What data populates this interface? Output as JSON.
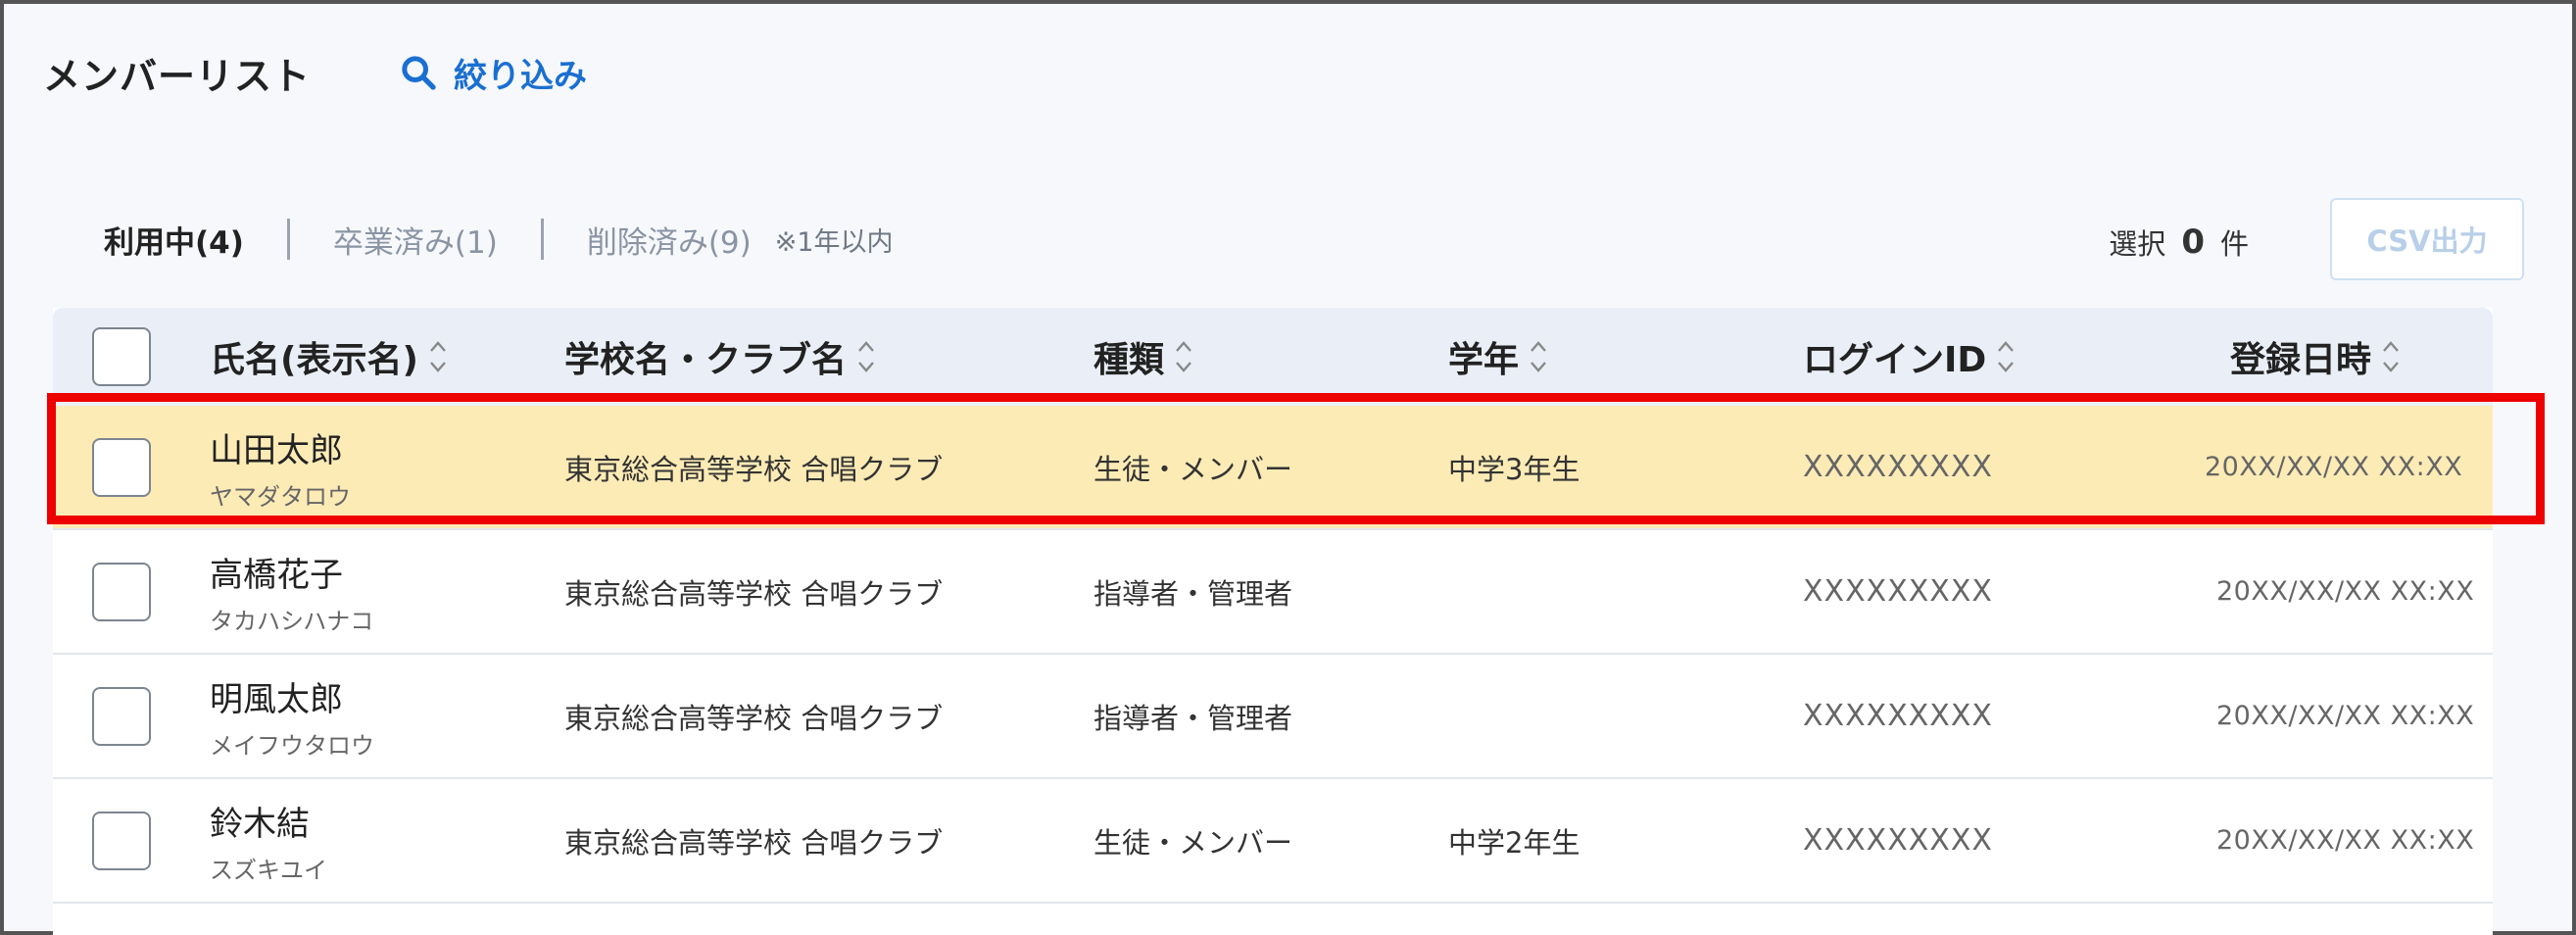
{
  "header": {
    "title": "メンバーリスト",
    "filter_label": "絞り込み"
  },
  "tabs": [
    {
      "label": "利用中(4)",
      "active": true
    },
    {
      "label": "卒業済み(1)",
      "active": false
    },
    {
      "label": "削除済み(9)",
      "active": false
    }
  ],
  "tab_note": "※1年以内",
  "selection": {
    "prefix": "選択",
    "count": "0",
    "suffix": "件"
  },
  "csv_button": "CSV出力",
  "columns": {
    "name": "氏名(表示名)",
    "school": "学校名・クラブ名",
    "type": "種類",
    "grade": "学年",
    "login": "ログインID",
    "registered": "登録日時"
  },
  "rows": [
    {
      "name": "山田太郎",
      "kana": "ヤマダタロウ",
      "school": "東京総合高等学校 合唱クラブ",
      "type": "生徒・メンバー",
      "grade": "中学3年生",
      "login": "XXXXXXXXX",
      "registered": "20XX/XX/XX XX:XX",
      "highlighted": true
    },
    {
      "name": "高橋花子",
      "kana": "タカハシハナコ",
      "school": "東京総合高等学校 合唱クラブ",
      "type": "指導者・管理者",
      "grade": "",
      "login": "XXXXXXXXX",
      "registered": "20XX/XX/XX XX:XX",
      "highlighted": false
    },
    {
      "name": "明風太郎",
      "kana": "メイフウタロウ",
      "school": "東京総合高等学校 合唱クラブ",
      "type": "指導者・管理者",
      "grade": "",
      "login": "XXXXXXXXX",
      "registered": "20XX/XX/XX XX:XX",
      "highlighted": false
    },
    {
      "name": "鈴木結",
      "kana": "スズキユイ",
      "school": "東京総合高等学校 合唱クラブ",
      "type": "生徒・メンバー",
      "grade": "中学2年生",
      "login": "XXXXXXXXX",
      "registered": "20XX/XX/XX XX:XX",
      "highlighted": false
    }
  ],
  "colors": {
    "accent": "#1a6fd1",
    "highlight_bg": "#fdebb6",
    "highlight_border": "#ee0000",
    "header_bg": "#eaeff7"
  },
  "icons": {
    "filter": "search-icon",
    "sort": "sort-icon"
  }
}
